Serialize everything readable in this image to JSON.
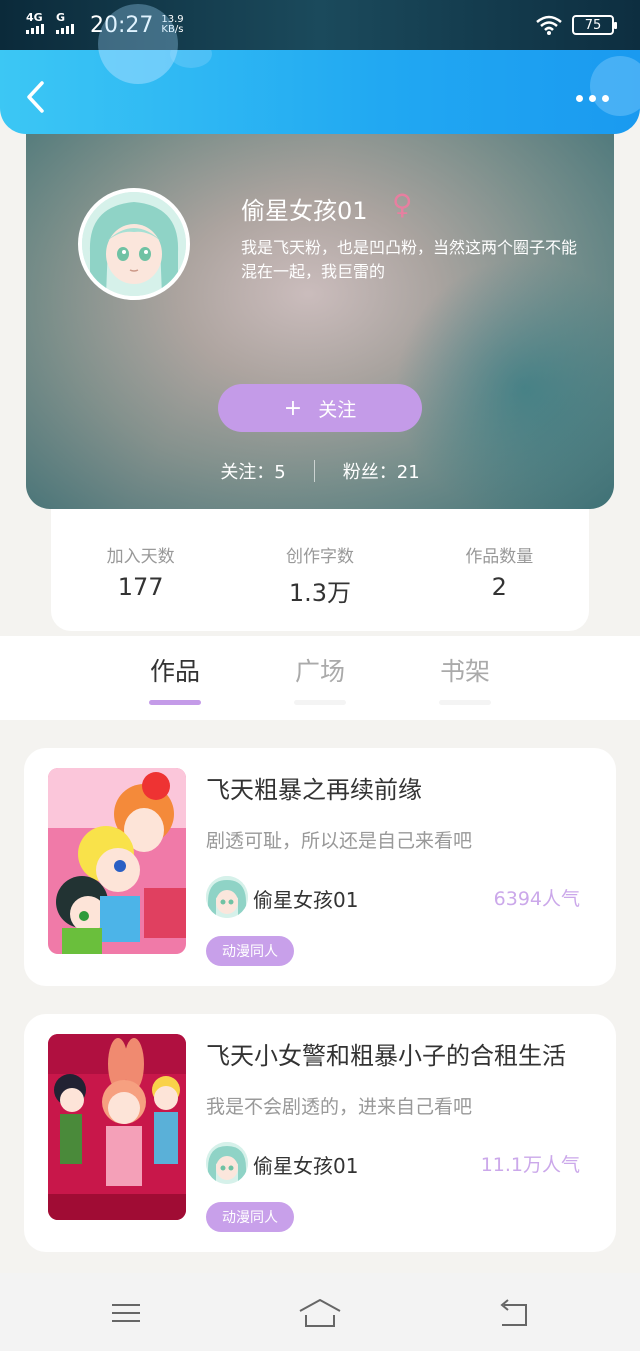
{
  "status_bar": {
    "network_1": "4G",
    "network_2": "G",
    "time": "20:27",
    "speed_value": "13.9",
    "speed_unit": "KB/s",
    "battery": "75"
  },
  "header": {
    "back_icon": "chevron-left-icon",
    "more_icon": "more-horizontal-icon"
  },
  "profile": {
    "nickname": "偷星女孩01",
    "gender_symbol": "♀",
    "gender_color": "#e77fa0",
    "bio": "我是飞天粉，也是凹凸粉，当然这两个圈子不能混在一起，我巨雷的",
    "follow_plus": "+",
    "follow_label": "关注",
    "following_text": "关注：5",
    "followers_text": "粉丝：21"
  },
  "stats": [
    {
      "label": "加入天数",
      "value": "177"
    },
    {
      "label": "创作字数",
      "value": "1.3万"
    },
    {
      "label": "作品数量",
      "value": "2"
    }
  ],
  "tabs": [
    {
      "label": "作品",
      "active": true
    },
    {
      "label": "广场",
      "active": false
    },
    {
      "label": "书架",
      "active": false
    }
  ],
  "works": [
    {
      "title": "飞天粗暴之再续前缘",
      "description": "剧透可耻，所以还是自己来看吧",
      "author": "偷星女孩01",
      "popularity": "6394人气",
      "tag": "动漫同人"
    },
    {
      "title": "飞天小女警和粗暴小子的合租生活",
      "description": "我是不会剧透的，进来自己看吧",
      "author": "偷星女孩01",
      "popularity": "11.1万人气",
      "tag": "动漫同人"
    }
  ],
  "nav": {
    "menu_icon": "menu-icon",
    "home_icon": "home-icon",
    "back_icon": "return-icon"
  },
  "colors": {
    "accent": "#c49be8",
    "header_blue": "#21a8f2",
    "popularity": "#cba8ea"
  }
}
